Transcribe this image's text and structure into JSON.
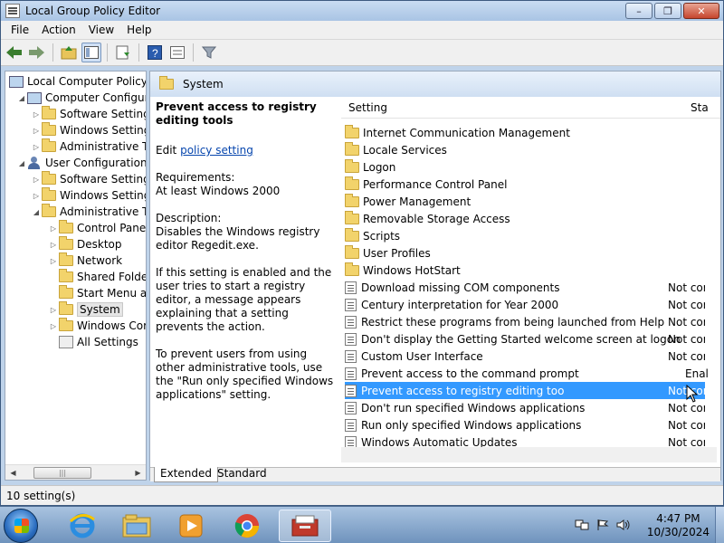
{
  "window": {
    "title": "Local Group Policy Editor",
    "buttons": {
      "minimize": "–",
      "maximize": "❐",
      "close": "✕"
    }
  },
  "menu": [
    "File",
    "Action",
    "View",
    "Help"
  ],
  "toolbar": {
    "icons": [
      "back-icon",
      "forward-icon",
      "up-folder-icon",
      "show-hide-tree-icon",
      "export-list-icon",
      "help-icon",
      "properties-icon",
      "filter-icon"
    ]
  },
  "tree": {
    "root": "Local Computer Policy",
    "computer_configuration": "Computer Configura",
    "cc_children": [
      "Software Settings",
      "Windows Setting",
      "Administrative Te"
    ],
    "user_configuration": "User Configuration",
    "uc_children": [
      "Software Settings",
      "Windows Setting",
      "Administrative Te"
    ],
    "admin_children": [
      "Control Panel",
      "Desktop",
      "Network",
      "Shared Folder",
      "Start Menu ar",
      "System",
      "Windows Cor",
      "All Settings"
    ],
    "scroll_grip": "|||"
  },
  "right_header": "System",
  "description": {
    "title": "Prevent access to registry editing tools",
    "edit_prefix": "Edit",
    "edit_link": "policy setting",
    "requirements_label": "Requirements:",
    "requirements_value": "At least Windows 2000",
    "description_label": "Description:",
    "description_text": "Disables the Windows registry editor Regedit.exe.",
    "para2": "If this setting is enabled and the user tries to start a registry editor, a message appears explaining that a setting prevents the action.",
    "para3": "To prevent users from using other administrative tools, use the \"Run only specified Windows applications\" setting."
  },
  "list": {
    "columns": {
      "setting": "Setting",
      "state": "Sta"
    },
    "folders": [
      "Internet Communication Management",
      "Locale Services",
      "Logon",
      "Performance Control Panel",
      "Power Management",
      "Removable Storage Access",
      "Scripts",
      "User Profiles",
      "Windows HotStart"
    ],
    "policies": [
      {
        "name": "Download missing COM components",
        "state": "Not cor"
      },
      {
        "name": "Century interpretation for Year 2000",
        "state": "Not cor"
      },
      {
        "name": "Restrict these programs from being launched from Help",
        "state": "Not cor"
      },
      {
        "name": "Don't display the Getting Started welcome screen at logon",
        "state": "Not cor"
      },
      {
        "name": "Custom User Interface",
        "state": "Not cor"
      },
      {
        "name": "Prevent access to the command prompt",
        "state": "Enal"
      },
      {
        "name": "Prevent access to registry editing too",
        "state": "Not cor"
      },
      {
        "name": "Don't run specified Windows applications",
        "state": "Not cor"
      },
      {
        "name": "Run only specified Windows applications",
        "state": "Not cor"
      },
      {
        "name": "Windows Automatic Updates",
        "state": "Not cor"
      }
    ],
    "selected_index": 6
  },
  "tabs": [
    "Extended",
    "Standard"
  ],
  "status": "10 setting(s)",
  "taskbar": {
    "apps": [
      "internet-explorer-icon",
      "file-explorer-icon",
      "media-player-icon",
      "chrome-icon",
      "group-policy-editor-icon"
    ],
    "time": "4:47 PM",
    "date": "10/30/2024"
  },
  "colors": {
    "selection": "#3399ff",
    "link": "#0645ad",
    "titlebar": "#bfd3ea"
  }
}
